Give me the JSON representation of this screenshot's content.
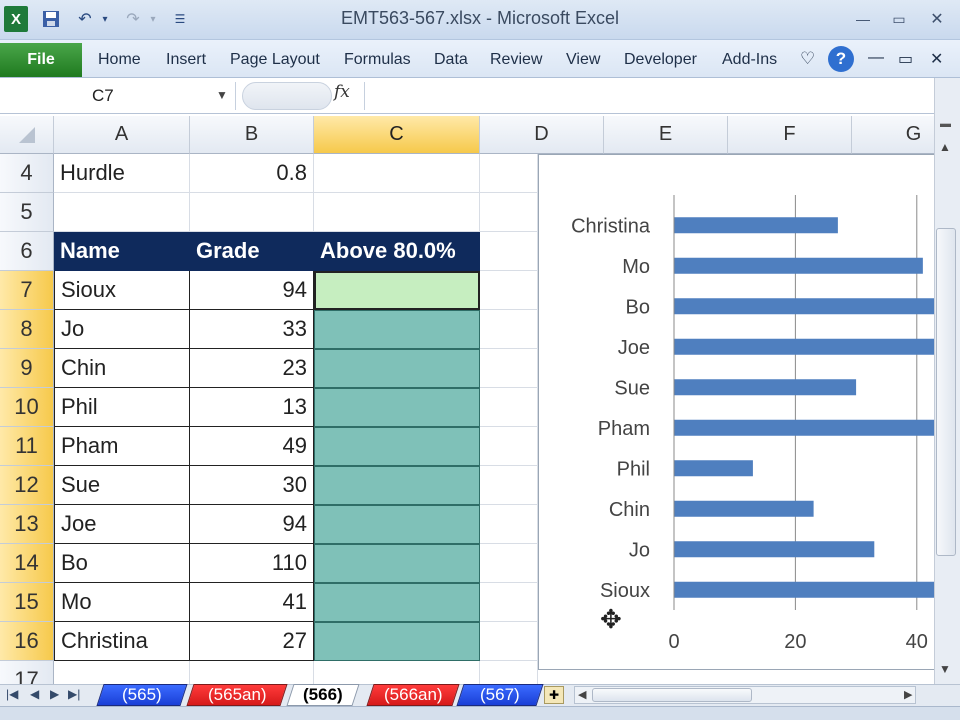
{
  "window": {
    "title": "EMT563-567.xlsx  -  Microsoft Excel"
  },
  "ribbon": {
    "file_label": "File",
    "tabs": [
      "Home",
      "Insert",
      "Page Layout",
      "Formulas",
      "Data",
      "Review",
      "View",
      "Developer",
      "Add-Ins"
    ]
  },
  "formula_bar": {
    "name_box": "C7",
    "fx_label": "fx",
    "content": ""
  },
  "columns": [
    "A",
    "B",
    "C",
    "D",
    "E",
    "F",
    "G"
  ],
  "selected_column": "C",
  "rows": [
    {
      "num": "4",
      "a": "Hurdle",
      "b": "0.8",
      "c": ""
    },
    {
      "num": "5",
      "a": "",
      "b": "",
      "c": ""
    },
    {
      "num": "6",
      "a": "Name",
      "b": "Grade",
      "c": "Above 80.0%"
    },
    {
      "num": "7",
      "a": "Sioux",
      "b": "94",
      "c": ""
    },
    {
      "num": "8",
      "a": "Jo",
      "b": "33",
      "c": ""
    },
    {
      "num": "9",
      "a": "Chin",
      "b": "23",
      "c": ""
    },
    {
      "num": "10",
      "a": "Phil",
      "b": "13",
      "c": ""
    },
    {
      "num": "11",
      "a": "Pham",
      "b": "49",
      "c": ""
    },
    {
      "num": "12",
      "a": "Sue",
      "b": "30",
      "c": ""
    },
    {
      "num": "13",
      "a": "Joe",
      "b": "94",
      "c": ""
    },
    {
      "num": "14",
      "a": "Bo",
      "b": "110",
      "c": ""
    },
    {
      "num": "15",
      "a": "Mo",
      "b": "41",
      "c": ""
    },
    {
      "num": "16",
      "a": "Christina",
      "b": "27",
      "c": ""
    },
    {
      "num": "17",
      "a": "",
      "b": "",
      "c": ""
    }
  ],
  "chart_data": {
    "type": "bar",
    "orientation": "horizontal",
    "categories": [
      "Christina",
      "Mo",
      "Bo",
      "Joe",
      "Sue",
      "Pham",
      "Phil",
      "Chin",
      "Jo",
      "Sioux"
    ],
    "values": [
      27,
      41,
      110,
      94,
      30,
      49,
      13,
      23,
      33,
      94
    ],
    "xticks": [
      "0",
      "20",
      "40"
    ],
    "xlim": [
      0,
      43
    ],
    "grid": true,
    "bar_color": "#4f7fbf"
  },
  "sheet_tabs": [
    {
      "label": "(565)",
      "color": "blue"
    },
    {
      "label": "(565an)",
      "color": "red"
    },
    {
      "label": "(566)",
      "color": "active"
    },
    {
      "label": "(566an)",
      "color": "red"
    },
    {
      "label": "(567)",
      "color": "blue"
    }
  ],
  "colors": {
    "header_fill": "#0f2a5c",
    "teal_fill": "#7fc1b8",
    "active_fill": "#c6eec0",
    "selected_header": "#f6c94b"
  }
}
